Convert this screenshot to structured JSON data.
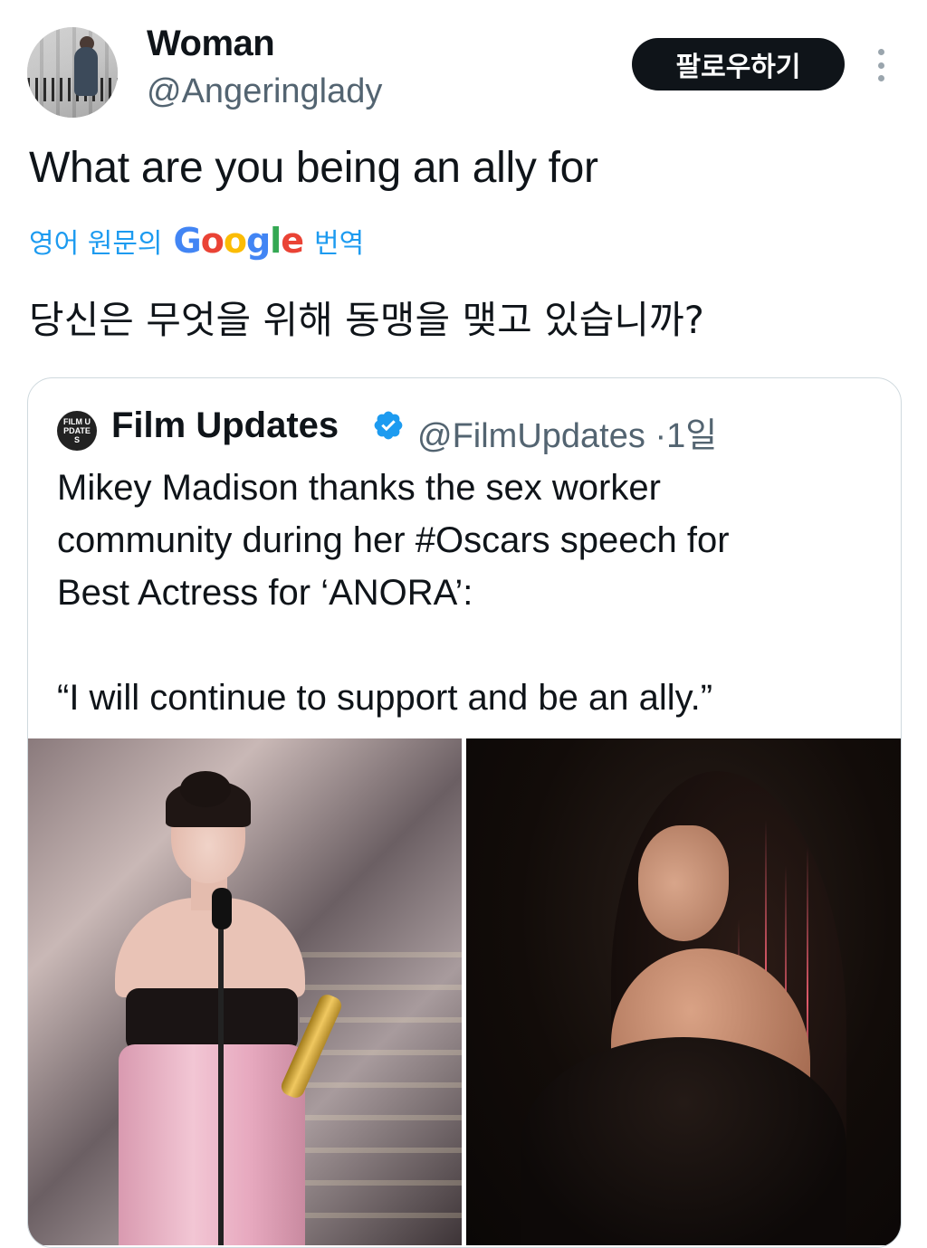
{
  "author": {
    "name": "Woman",
    "handle": "@Angeringlady",
    "avatar_icon": "profile-photo"
  },
  "actions": {
    "follow_label": "팔로우하기",
    "more_icon": "vertical-ellipsis-icon"
  },
  "tweet": {
    "text": "What are you being an ally for",
    "translation_prefix": "영어 원문의",
    "translation_brand": "Google",
    "translation_suffix": "번역",
    "translated_text": "당신은 무엇을 위해 동맹을 맺고 있습니까?"
  },
  "quoted_tweet": {
    "name": "Film Updates",
    "logo_text": "FILM UPDATES",
    "verified_icon": "verified-badge-icon",
    "handle": "@FilmUpdates",
    "separator": "·",
    "time": "1일",
    "text": "Mikey Madison thanks the sex worker\ncommunity during her #Oscars speech for\nBest Actress for ‘ANORA’:\n\n“I will continue to support and be an ally.”",
    "images": [
      "oscars-speech-photo",
      "portrait-photo"
    ]
  },
  "colors": {
    "link_blue": "#1d9bf0",
    "secondary_text": "#536471",
    "primary_text": "#0f1419",
    "border": "#cfd9de",
    "google_blue": "#4285F4",
    "google_red": "#EA4335",
    "google_yellow": "#FBBC05",
    "google_green": "#34A853"
  }
}
